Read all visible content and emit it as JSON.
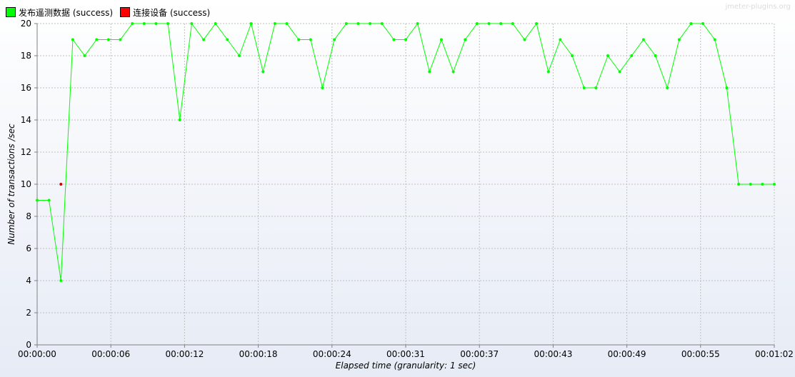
{
  "watermark": "jmeter-plugins.org",
  "chart_data": {
    "type": "line",
    "xlabel": "Elapsed time (granularity: 1 sec)",
    "ylabel": "Number of transactions /sec",
    "ylim": [
      0,
      20
    ],
    "xlim": [
      0,
      62
    ],
    "grid": true,
    "legend_placement": "top-left",
    "x_tick_labels": [
      "00:00:00",
      "00:00:06",
      "00:00:12",
      "00:00:18",
      "00:00:24",
      "00:00:31",
      "00:00:37",
      "00:00:43",
      "00:00:49",
      "00:00:55",
      "00:01:02"
    ],
    "y_ticks": [
      0,
      2,
      4,
      6,
      8,
      10,
      12,
      14,
      16,
      18,
      20
    ],
    "series": [
      {
        "name": "发布遥测数据 (success)",
        "color": "#00ff00",
        "x": [
          0,
          1,
          2,
          3,
          4,
          5,
          6,
          7,
          8,
          9,
          10,
          11,
          12,
          13,
          14,
          15,
          16,
          17,
          18,
          19,
          20,
          21,
          22,
          23,
          24,
          25,
          26,
          27,
          28,
          29,
          30,
          31,
          32,
          33,
          34,
          35,
          36,
          37,
          38,
          39,
          40,
          41,
          42,
          43,
          44,
          45,
          46,
          47,
          48,
          49,
          50,
          51,
          52,
          53,
          54,
          55,
          56,
          57,
          58,
          59,
          60,
          61,
          62
        ],
        "values": [
          9,
          9,
          4,
          19,
          18,
          19,
          19,
          19,
          20,
          20,
          20,
          20,
          14,
          20,
          19,
          20,
          19,
          18,
          20,
          17,
          20,
          20,
          19,
          19,
          16,
          19,
          20,
          20,
          20,
          20,
          19,
          19,
          20,
          17,
          19,
          17,
          19,
          20,
          20,
          20,
          20,
          19,
          20,
          17,
          19,
          18,
          16,
          16,
          18,
          17,
          18,
          19,
          18,
          16,
          19,
          20,
          20,
          19,
          16,
          10,
          10,
          10,
          10
        ]
      },
      {
        "name": "连接设备 (success)",
        "color": "#ff0000",
        "x": [
          2
        ],
        "values": [
          10
        ]
      }
    ]
  }
}
